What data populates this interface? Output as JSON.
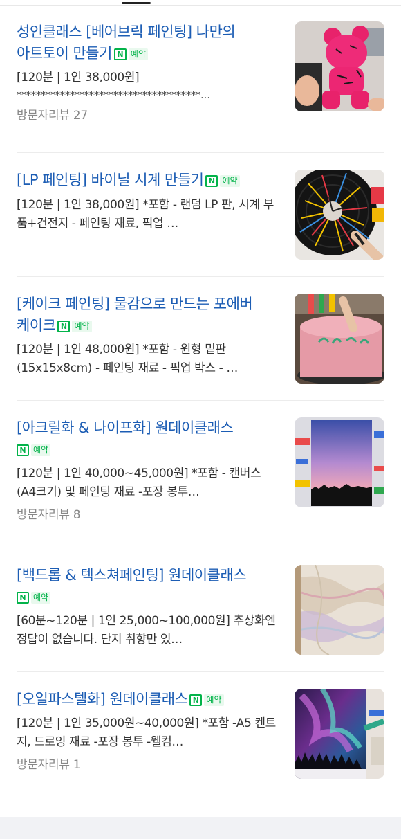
{
  "badge": {
    "label": "예약",
    "icon": "naver-n-icon"
  },
  "items": [
    {
      "title": "성인클래스 [베어브릭 페인팅] 나만의 아트토이 만들기",
      "desc1": "[120분 | 1인 38,000원]",
      "desc2": "**************************************…",
      "review": "방문자리뷰 27",
      "image": "pink-bearbrick-figure-painting"
    },
    {
      "title": "[LP 페인팅] 바이닐 시계 만들기",
      "desc": "[120분 | 1인 38,000원] *포함 - 랜덤 LP 판, 시계 부품+건전지 - 페인팅 재료, 픽업 …",
      "image": "painted-vinyl-record-clock"
    },
    {
      "title": "[케이크 페인팅] 물감으로 만드는 포에버 케이크",
      "desc": "[120분 | 1인 48,000원] *포함 - 원형 밑판 (15x15x8cm) - 페인팅 재료 - 픽업 박스 - …",
      "image": "pink-painted-cake"
    },
    {
      "title": "[아크릴화 & 나이프화] 원데이클래스",
      "desc": "[120분 | 1인 40,000~45,000원] *포함 - 캔버스(A4크기) 및 페인팅 재료 -포장 봉투…",
      "review": "방문자리뷰 8",
      "image": "sunset-acrylic-painting"
    },
    {
      "title": "[백드롭 & 텍스쳐페인팅] 원데이클래스",
      "desc": "[60분~120분 | 1인 25,000~100,000원] 추상화엔 정답이 없습니다. 단지 취향만 있…",
      "image": "marble-texture-painting"
    },
    {
      "title": "[오일파스텔화] 원데이클래스",
      "desc": "[120분 | 1인 35,000원~40,000원] *포함 -A5 켄트지, 드로잉 재료 -포장 봉투 -웰컴…",
      "review": "방문자리뷰 1",
      "image": "aurora-oil-pastel-drawing"
    }
  ]
}
